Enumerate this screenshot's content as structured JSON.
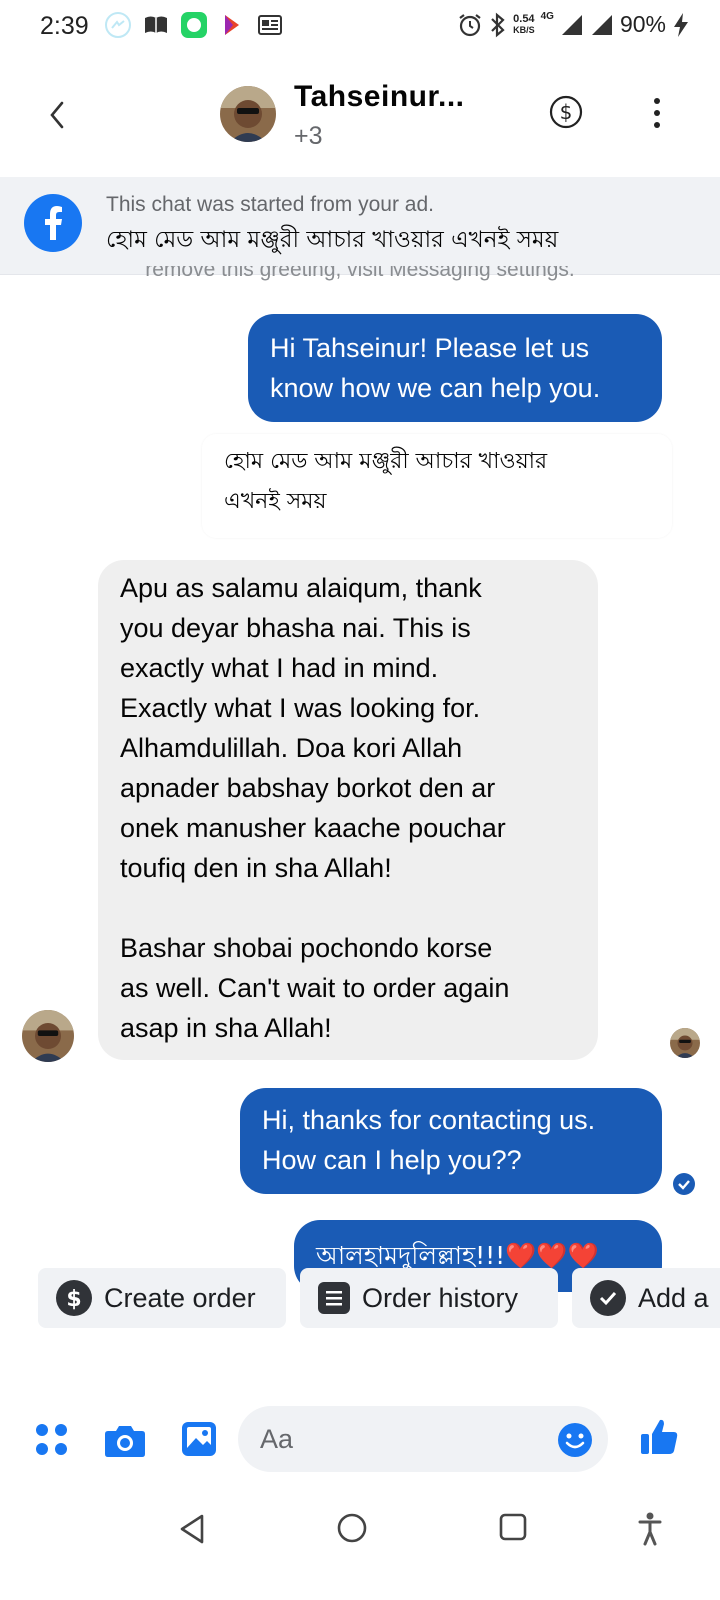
{
  "status_bar": {
    "time": "2:39",
    "net_speed_top": "0.54",
    "net_speed_bottom": "KB/S",
    "network": "4G",
    "battery": "90%"
  },
  "header": {
    "contact_name": "Tahseinur...",
    "subtitle": "+3"
  },
  "ad_banner": {
    "line1": "This chat was started from your ad.",
    "line2": "হোম মেড আম মঞ্জুরী আচার খাওয়ার এখনই সময়"
  },
  "greeting_note": "remove this greeting, visit Messaging settings.",
  "messages": {
    "greeting": {
      "line1": "Hi Tahseinur! Please let us",
      "line2": "know how we can help you."
    },
    "quote": {
      "line1": "হোম মেড আম মঞ্জুরী আচার খাওয়ার",
      "line2": "এখনই সময়"
    },
    "customer": {
      "lines": [
        "Apu as salamu alaiqum, thank",
        "you deyar bhasha nai. This is",
        "exactly what I had in mind.",
        "Exactly what I was looking for.",
        "Alhamdulillah. Doa kori Allah",
        "apnader babshay borkot den ar",
        "onek manusher kaache pouchar",
        "toufiq den in sha Allah!",
        "",
        "Bashar shobai pochondo korse",
        "as well. Can't wait to order again",
        "asap in sha Allah!"
      ]
    },
    "reply1": {
      "line1": "Hi, thanks for contacting us.",
      "line2": "How can I help you??"
    },
    "reply2": {
      "text": "আলহামদুলিল্লাহ!!!",
      "hearts": "❤️❤️❤️"
    }
  },
  "quick_replies": [
    {
      "label": "Create order",
      "icon": "dollar-icon"
    },
    {
      "label": "Order history",
      "icon": "list-icon"
    },
    {
      "label": "Add a",
      "icon": "check-icon"
    }
  ],
  "composer": {
    "placeholder": "Aa"
  },
  "colors": {
    "accent": "#1877f2",
    "outgoing_bubble": "#1a5bb5",
    "incoming_bubble": "#efefef"
  }
}
